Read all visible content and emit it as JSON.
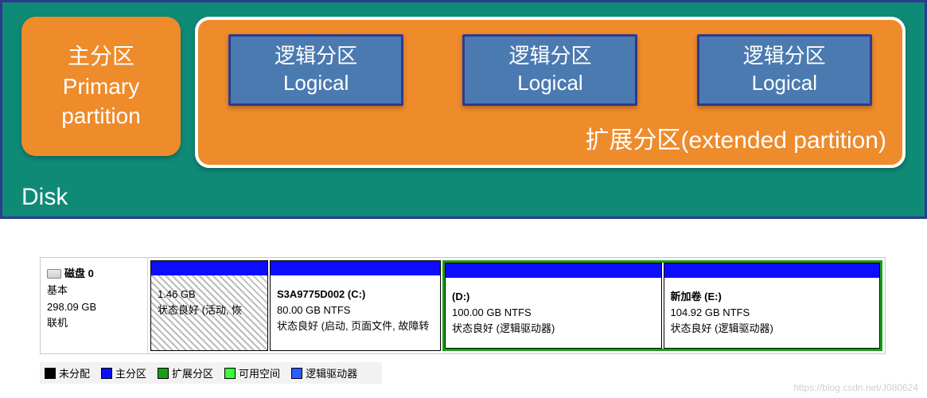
{
  "diagram": {
    "primary": {
      "zh": "主分区",
      "en1": "Primary",
      "en2": "partition"
    },
    "extended": {
      "label": "扩展分区(extended partition)"
    },
    "logical": {
      "zh": "逻辑分区",
      "en": "Logical"
    },
    "disk_label": "Disk"
  },
  "diskmgmt": {
    "header": {
      "disk_title": "磁盘 0",
      "type": "基本",
      "size": "298.09 GB",
      "status": "联机"
    },
    "parts": {
      "unallocated": {
        "size": "1.46 GB",
        "status": "状态良好 (活动, 恢"
      },
      "c": {
        "title": "S3A9775D002  (C:)",
        "size": "80.00 GB NTFS",
        "status": "状态良好 (启动, 页面文件, 故障转"
      },
      "d": {
        "title": "(D:)",
        "size": "100.00 GB NTFS",
        "status": "状态良好 (逻辑驱动器)"
      },
      "e": {
        "title": "新加卷  (E:)",
        "size": "104.92 GB NTFS",
        "status": "状态良好 (逻辑驱动器)"
      }
    }
  },
  "legend": {
    "unallocated": "未分配",
    "primary": "主分区",
    "extended": "扩展分区",
    "free": "可用空间",
    "logical": "逻辑驱动器"
  },
  "watermark": "https://blog.csdn.net/J080624"
}
